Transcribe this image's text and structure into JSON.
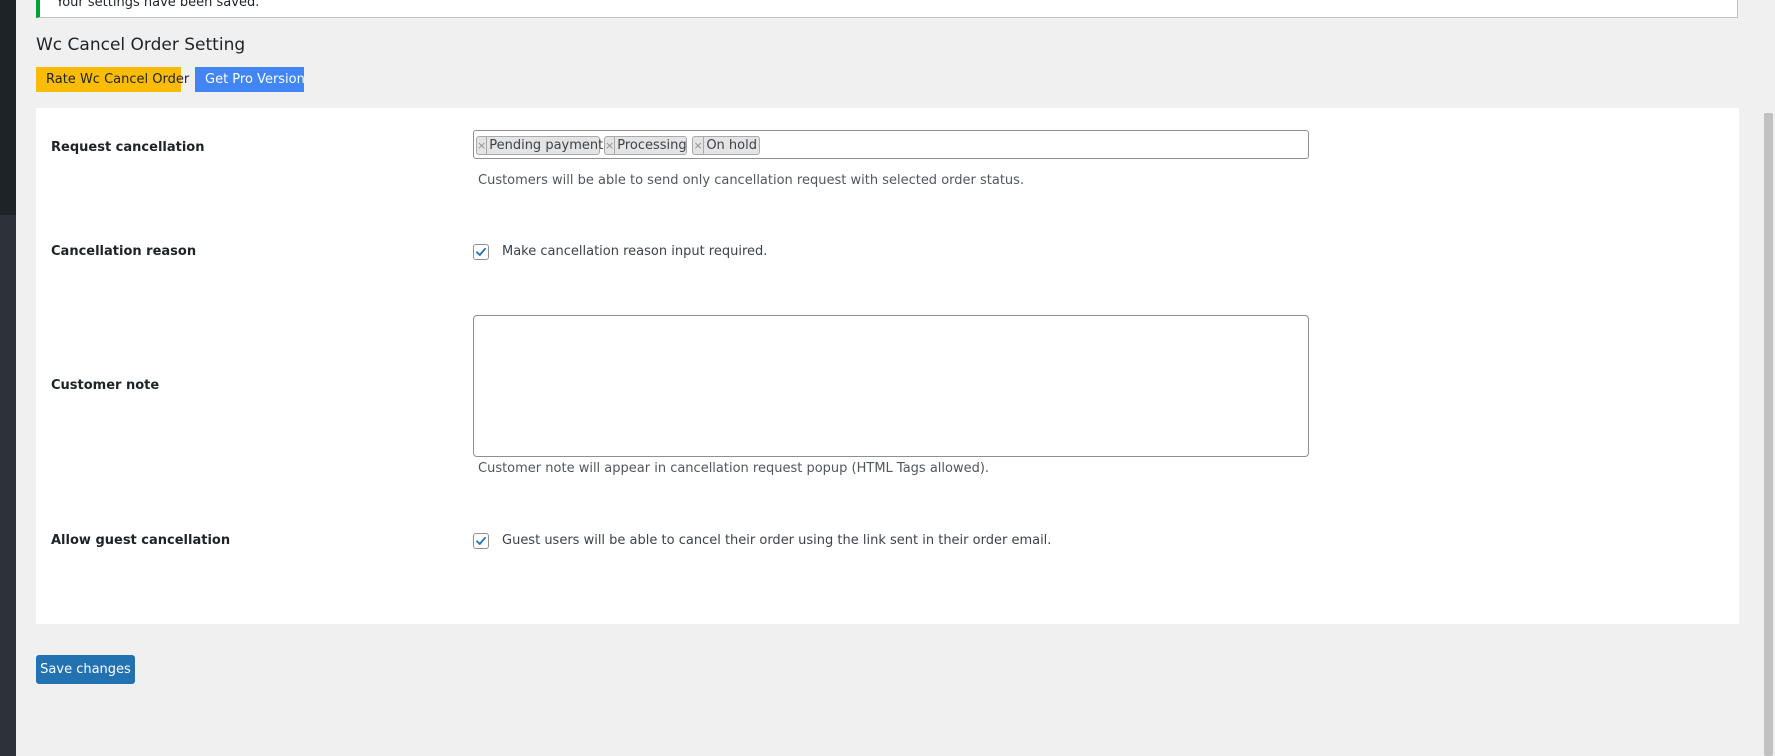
{
  "notice": {
    "text": "Your settings have been saved."
  },
  "page": {
    "title": "Wc Cancel Order Setting"
  },
  "header_buttons": {
    "rate_label": "Rate Wc Cancel Order",
    "pro_label": "Get Pro Version"
  },
  "fields": {
    "request_cancellation": {
      "label": "Request cancellation",
      "selected": [
        {
          "remove": "×",
          "label": "Pending payment"
        },
        {
          "remove": "×",
          "label": "Processing"
        },
        {
          "remove": "×",
          "label": "On hold"
        }
      ],
      "description": "Customers will be able to send only cancellation request with selected order status."
    },
    "cancellation_reason": {
      "label": "Cancellation reason",
      "checked": true,
      "checkbox_label": "Make cancellation reason input required."
    },
    "customer_note": {
      "label": "Customer note",
      "value": "",
      "description": "Customer note will appear in cancellation request popup (HTML Tags allowed)."
    },
    "guest_cancellation": {
      "label": "Allow guest cancellation",
      "checked": true,
      "checkbox_label": "Guest users will be able to cancel their order using the link sent in their order email."
    }
  },
  "footer": {
    "save_label": "Save changes"
  },
  "colors": {
    "notice_border": "#00a32a",
    "rate_button": "#fbbc05",
    "pro_button": "#4285f4",
    "primary": "#2271b1",
    "checkbox_check": "#2271b1"
  },
  "icons": {
    "checkbox": "checkmark-icon",
    "chip_remove": "close-icon"
  }
}
